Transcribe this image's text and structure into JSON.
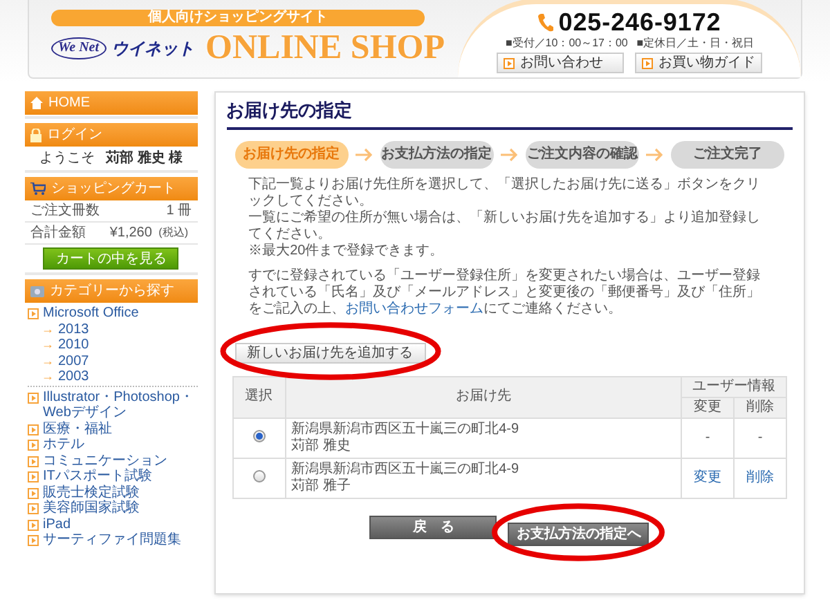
{
  "header": {
    "tagline": "個人向けショッピングサイト",
    "logo_mark": "We Net",
    "logo_text": "ウイネット",
    "shop_title": "ONLINE SHOP",
    "phone": "025-246-9172",
    "hours": "■受付／10：00～17：00",
    "holidays": "■定休日／土・日・祝日",
    "links": [
      {
        "label": "お問い合わせ"
      },
      {
        "label": "お買い物ガイド"
      }
    ]
  },
  "sidebar": {
    "home": "HOME",
    "login": {
      "title": "ログイン",
      "welcome": "ようこそ",
      "user": "苅部 雅史 様"
    },
    "cart": {
      "title": "ショッピングカート",
      "rows": [
        {
          "label": "ご注文冊数",
          "value": "1 冊"
        },
        {
          "label": "合計金額",
          "value": "¥1,260",
          "note": "(税込)"
        }
      ],
      "button": "カートの中を見る"
    },
    "categories": {
      "title": "カテゴリーから探す",
      "items": [
        {
          "label": "Microsoft Office",
          "children": [
            {
              "marker": "→",
              "label": "2013"
            },
            {
              "marker": "→",
              "label": "2010"
            },
            {
              "marker": "→",
              "label": "2007"
            },
            {
              "marker": "→",
              "label": "2003"
            }
          ]
        },
        {
          "label": "Illustrator・Photoshop・Webデザイン"
        },
        {
          "label": "医療・福祉"
        },
        {
          "label": "ホテル"
        },
        {
          "label": "コミュニケーション"
        },
        {
          "label": "ITパスポート試験"
        },
        {
          "label": "販売士検定試験"
        },
        {
          "label": "美容師国家試験"
        },
        {
          "label": "iPad"
        },
        {
          "label": "サーティファイ問題集"
        }
      ]
    }
  },
  "main": {
    "title": "お届け先の指定",
    "steps": [
      {
        "label": "お届け先の指定",
        "selected": true
      },
      {
        "label": "お支払方法の指定",
        "selected": false
      },
      {
        "label": "ご注文内容の確認",
        "selected": false
      },
      {
        "label": "ご注文完了",
        "selected": false
      }
    ],
    "instructions": [
      "下記一覧よりお届け先住所を選択して、「選択したお届け先に送る」ボタンをクリックしてください。",
      "一覧にご希望の住所が無い場合は、「新しいお届け先を追加する」より追加登録してください。",
      "※最大20件まで登録できます。"
    ],
    "notice": {
      "before": "すでに登録されている「ユーザー登録住所」を変更されたい場合は、ユーザー登録されている「氏名」及び「メールアドレス」と変更後の「郵便番号」及び「住所」をご記入の上、",
      "link": "お問い合わせフォーム",
      "after": "にてご連絡ください。"
    },
    "add_button": "新しいお届け先を追加する",
    "table": {
      "columns": {
        "select": "選択",
        "destination": "お届け先",
        "user_info": "ユーザー情報",
        "change": "変更",
        "delete": "削除"
      },
      "rows": [
        {
          "selected": true,
          "address": "新潟県新潟市西区五十嵐三の町北4-9",
          "name": "苅部 雅史",
          "change": "-",
          "delete": "-",
          "editable": false
        },
        {
          "selected": false,
          "address": "新潟県新潟市西区五十嵐三の町北4-9",
          "name": "苅部 雅子",
          "change": "変更",
          "delete": "削除",
          "editable": true
        }
      ]
    },
    "back_button": "戻　る",
    "next_button": "お支払方法の指定へ"
  }
}
